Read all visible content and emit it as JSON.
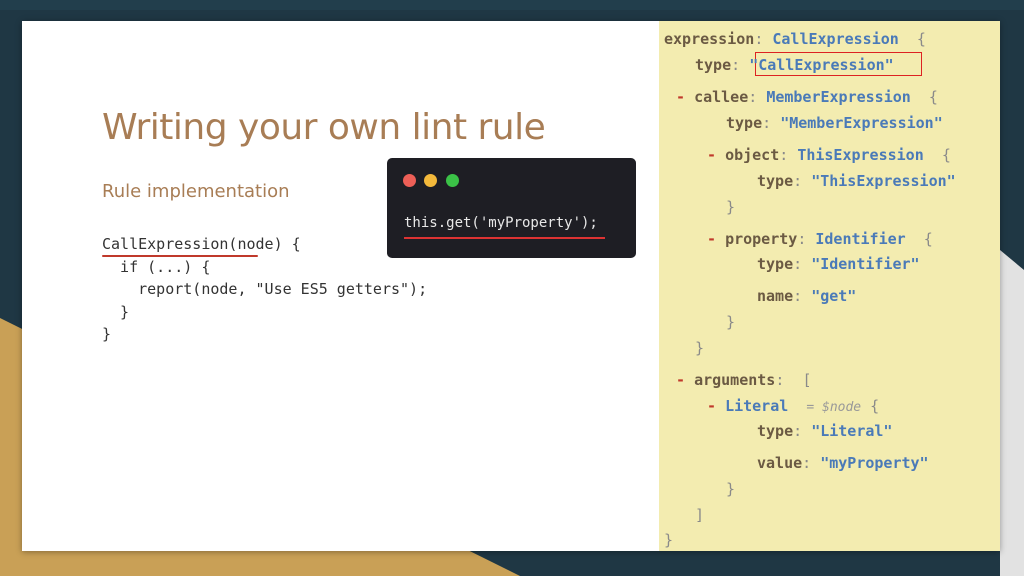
{
  "slide": {
    "title": "Writing your own lint rule",
    "subtitle": "Rule implementation",
    "code_lines": [
      "CallExpression(node) {",
      "  if (...) {",
      "    report(node, \"Use ES5 getters\");",
      "  }",
      "}"
    ]
  },
  "terminal": {
    "code": "this.get('myProperty');"
  },
  "ast": {
    "l1": {
      "key": "expression",
      "type": "CallExpression",
      "brace": "{"
    },
    "l2": {
      "key": "type",
      "value": "\"CallExpression\""
    },
    "l3": {
      "marker": "-",
      "key": "callee",
      "type": "MemberExpression",
      "brace": "{"
    },
    "l4": {
      "key": "type",
      "value": "\"MemberExpression\""
    },
    "l5": {
      "marker": "-",
      "key": "object",
      "type": "ThisExpression",
      "brace": "{"
    },
    "l6": {
      "key": "type",
      "value": "\"ThisExpression\""
    },
    "l7": {
      "brace": "}"
    },
    "l8": {
      "marker": "-",
      "key": "property",
      "type": "Identifier",
      "brace": "{"
    },
    "l9": {
      "key": "type",
      "value": "\"Identifier\""
    },
    "l10": {
      "key": "name",
      "value": "\"get\""
    },
    "l11": {
      "brace": "}"
    },
    "l12": {
      "brace": "}"
    },
    "l13": {
      "marker": "-",
      "key": "arguments",
      "brace": "["
    },
    "l14": {
      "marker": "-",
      "type": "Literal",
      "alias": "= $node",
      "brace": "{"
    },
    "l15": {
      "key": "type",
      "value": "\"Literal\""
    },
    "l16": {
      "key": "value",
      "value": "\"myProperty\""
    },
    "l17": {
      "brace": "}"
    },
    "l18": {
      "brace": "]"
    },
    "l19": {
      "brace": "}"
    }
  },
  "colors": {
    "accent": "#a87d55",
    "ast_panel": "#f3ecb0",
    "highlight": "#d22222"
  }
}
